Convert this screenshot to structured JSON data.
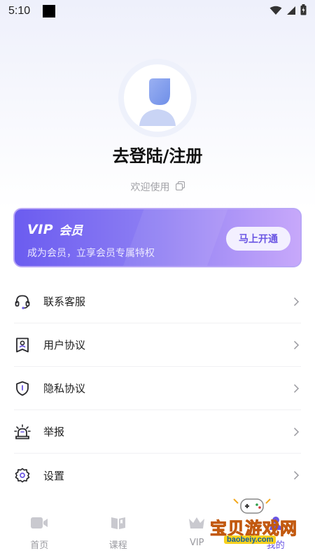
{
  "status_bar": {
    "time": "5:10"
  },
  "profile": {
    "login_text": "去登陆/注册",
    "welcome_text": "欢迎使用"
  },
  "vip_card": {
    "logo_text": "VIP",
    "label": "会员",
    "subtitle": "成为会员，立享会员专属特权",
    "button_label": "马上开通",
    "colors": {
      "start": "#6b5cf0",
      "end": "#c7a8fa",
      "button_text": "#6a55e3"
    }
  },
  "menu": {
    "items": [
      {
        "label": "联系客服",
        "icon": "headset-icon"
      },
      {
        "label": "用户协议",
        "icon": "user-agreement-icon"
      },
      {
        "label": "隐私协议",
        "icon": "shield-icon"
      },
      {
        "label": "举报",
        "icon": "alarm-icon"
      },
      {
        "label": "设置",
        "icon": "gear-icon"
      }
    ]
  },
  "bottom_nav": {
    "items": [
      {
        "label": "首页",
        "icon": "video-icon"
      },
      {
        "label": "课程",
        "icon": "book-icon"
      },
      {
        "label": "VIP",
        "icon": "vip-icon"
      },
      {
        "label": "我的",
        "icon": "profile-icon"
      }
    ]
  },
  "watermark": {
    "text": "宝贝游戏网",
    "url": "baobeiy.com"
  }
}
